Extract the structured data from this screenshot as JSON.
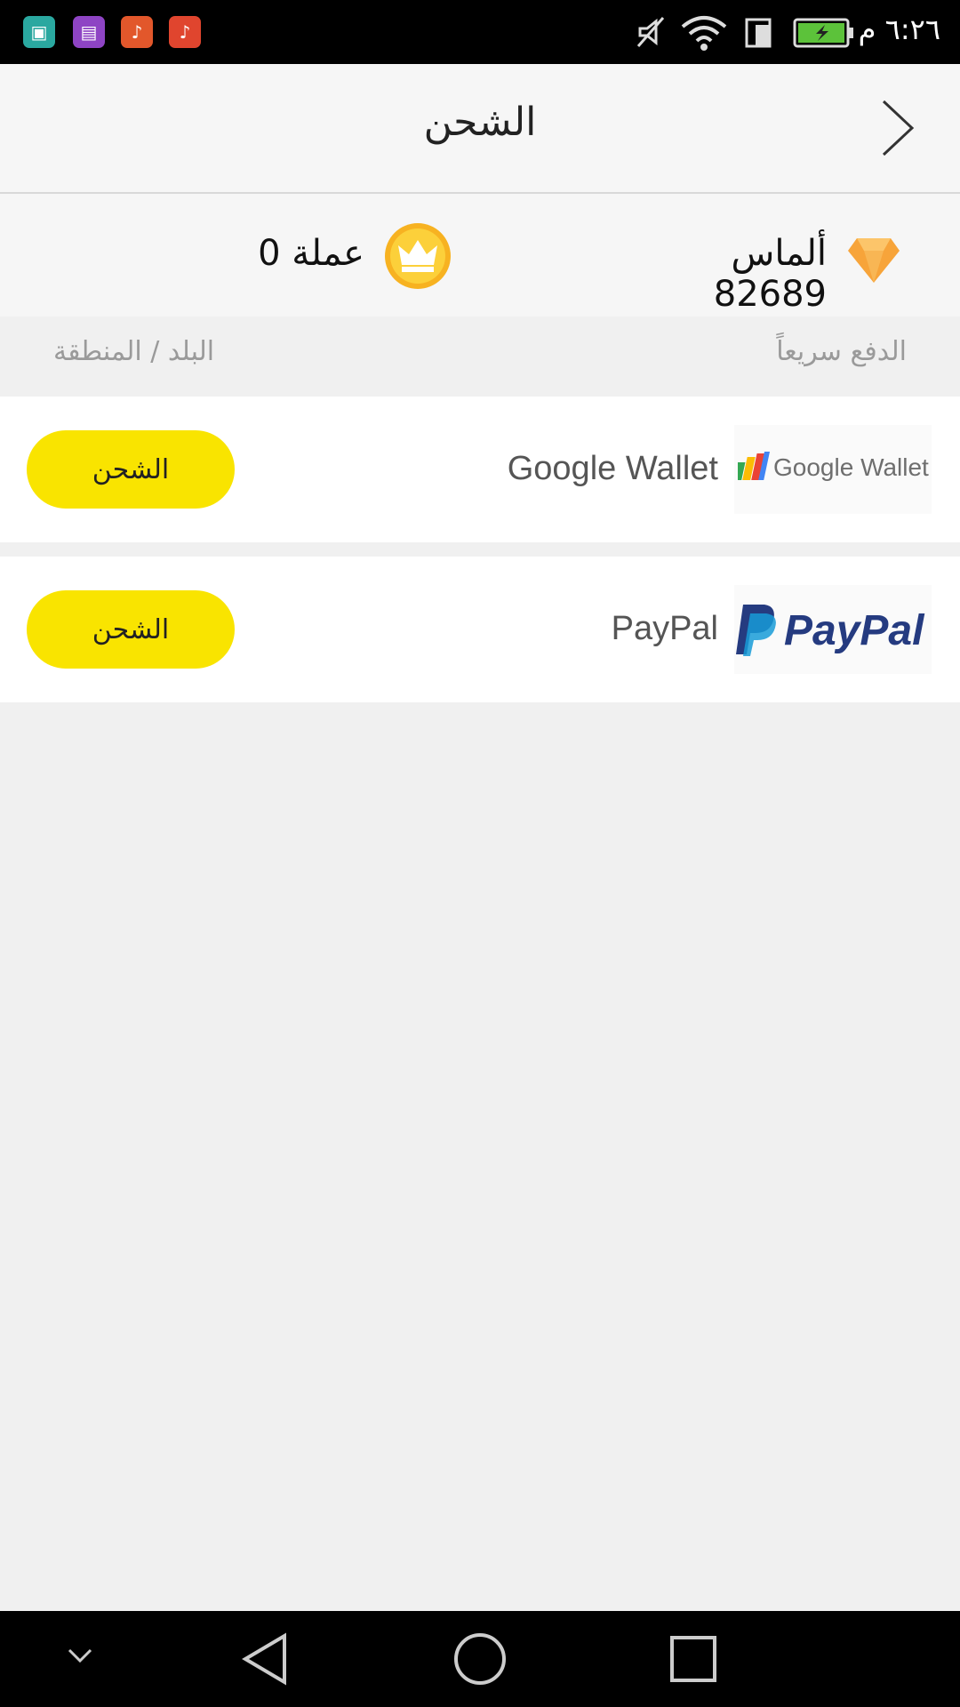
{
  "status_bar": {
    "time": "٦:٢٦ م"
  },
  "header": {
    "title": "الشحن"
  },
  "balance": {
    "diamonds_label": "ألماس 82689",
    "coins_label": "عملة 0"
  },
  "subheader": {
    "fast_pay": "الدفع سريعاً",
    "region": "البلد / المنطقة"
  },
  "payment_methods": [
    {
      "name": "Google Wallet",
      "logo_text": "Google Wallet",
      "button_label": "الشحن"
    },
    {
      "name": "PayPal",
      "logo_text": "PayPal",
      "button_label": "الشحن"
    }
  ],
  "colors": {
    "button_yellow": "#f9e400",
    "paypal_blue": "#253b80"
  }
}
